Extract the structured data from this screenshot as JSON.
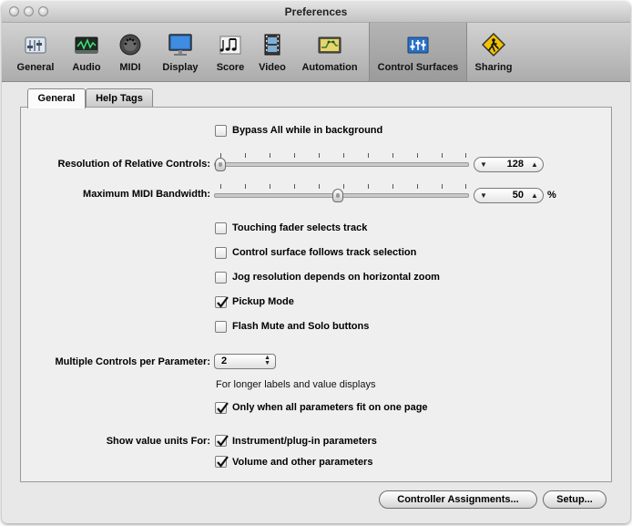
{
  "window": {
    "title": "Preferences"
  },
  "toolbar": {
    "items": [
      {
        "label": "General",
        "icon": "general-icon"
      },
      {
        "label": "Audio",
        "icon": "audio-icon"
      },
      {
        "label": "MIDI",
        "icon": "midi-icon"
      },
      {
        "label": "Display",
        "icon": "display-icon"
      },
      {
        "label": "Score",
        "icon": "score-icon"
      },
      {
        "label": "Video",
        "icon": "video-icon"
      },
      {
        "label": "Automation",
        "icon": "automation-icon"
      },
      {
        "label": "Control Surfaces",
        "icon": "control-surfaces-icon",
        "selected": true
      },
      {
        "label": "Sharing",
        "icon": "sharing-icon"
      }
    ]
  },
  "tabs": [
    {
      "label": "General",
      "active": true
    },
    {
      "label": "Help Tags",
      "active": false
    }
  ],
  "panel": {
    "bypass": {
      "label": "Bypass All while in background",
      "checked": false
    },
    "resolution": {
      "label": "Resolution of Relative Controls:",
      "value": "128",
      "slider_fraction": 0.0
    },
    "bandwidth": {
      "label": "Maximum MIDI Bandwidth:",
      "value": "50",
      "unit": "%",
      "slider_fraction": 0.5
    },
    "options": [
      {
        "label": "Touching fader selects track",
        "checked": false
      },
      {
        "label": "Control surface follows track selection",
        "checked": false
      },
      {
        "label": "Jog resolution depends on horizontal zoom",
        "checked": false
      },
      {
        "label": "Pickup Mode",
        "checked": true
      },
      {
        "label": "Flash Mute and Solo buttons",
        "checked": false
      }
    ],
    "multiple": {
      "label": "Multiple Controls per Parameter:",
      "value": "2",
      "hint": "For longer labels and value displays",
      "only_when": {
        "label": "Only when all parameters fit on one page",
        "checked": true
      }
    },
    "units": {
      "label": "Show value units For:",
      "instrument": {
        "label": "Instrument/plug-in parameters",
        "checked": true
      },
      "volume": {
        "label": "Volume and other parameters",
        "checked": true
      }
    }
  },
  "buttons": {
    "controller_assignments": "Controller Assignments...",
    "setup": "Setup..."
  },
  "colors": {
    "selected_toolbar": "#9b9b9b",
    "icon_blue": "#2a6fc4",
    "icon_yellow": "#f2c200"
  }
}
